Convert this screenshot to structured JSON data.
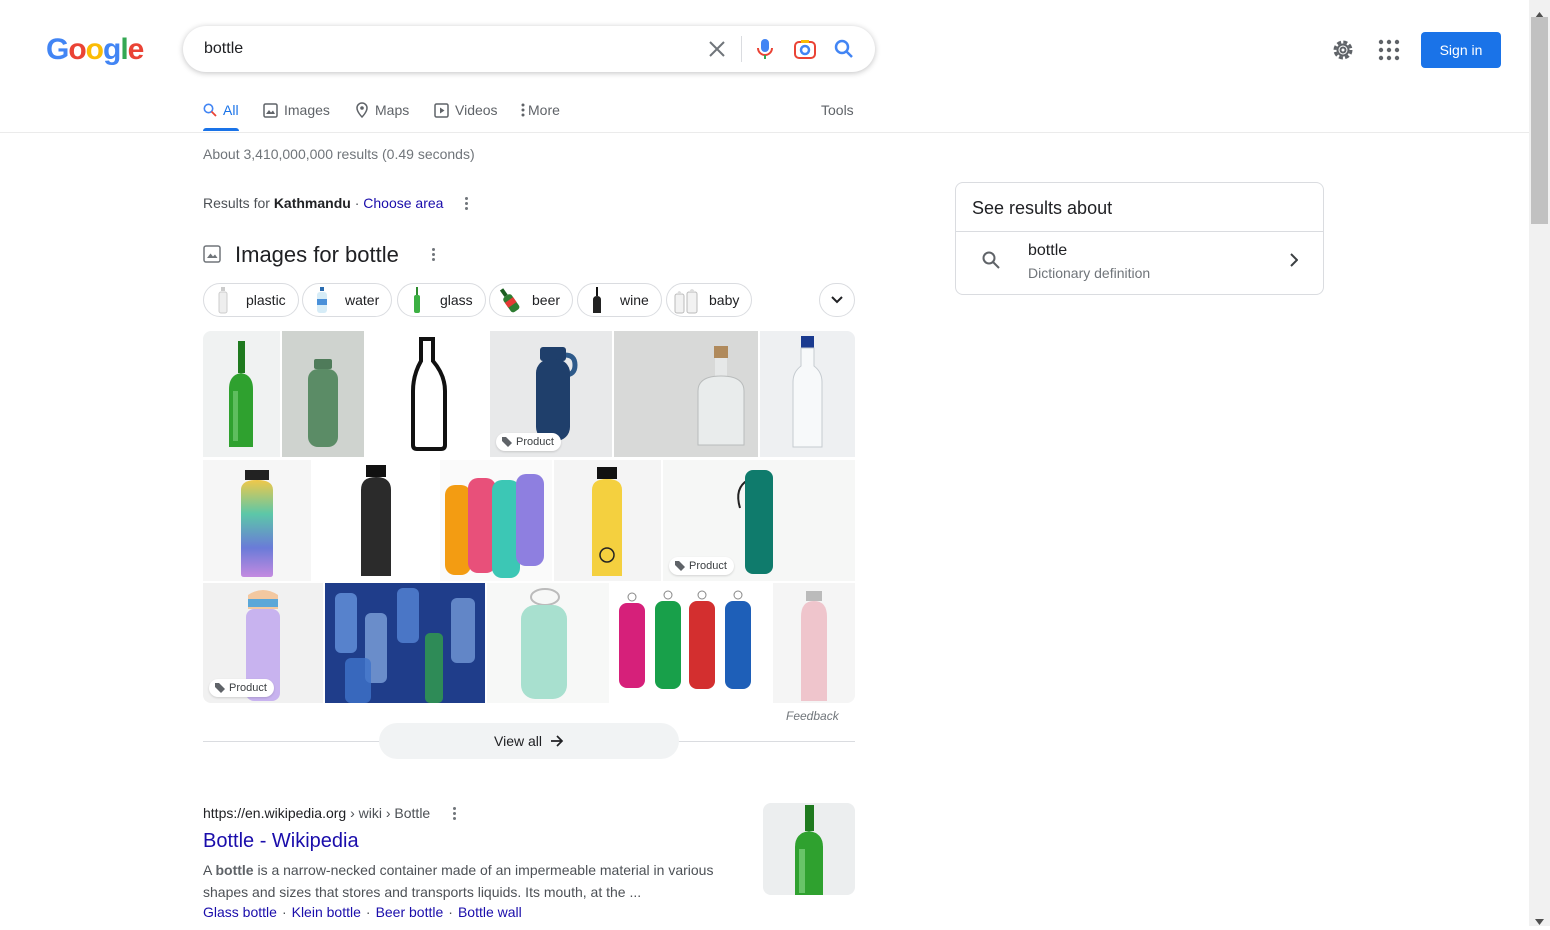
{
  "logo": {
    "letters": [
      "G",
      "o",
      "o",
      "g",
      "l",
      "e"
    ],
    "colors": [
      "#4285f4",
      "#ea4335",
      "#fbbc05",
      "#4285f4",
      "#34a853",
      "#ea4335"
    ]
  },
  "search": {
    "query": "bottle"
  },
  "header": {
    "sign_in": "Sign in"
  },
  "tabs": [
    {
      "label": "All",
      "icon": "search-icon",
      "active": true
    },
    {
      "label": "Images",
      "icon": "image-icon"
    },
    {
      "label": "Maps",
      "icon": "map-pin-icon"
    },
    {
      "label": "Videos",
      "icon": "video-icon"
    },
    {
      "label": "More",
      "icon": "more-vert-icon"
    }
  ],
  "tools_label": "Tools",
  "stats": "About 3,410,000,000 results (0.49 seconds)",
  "location": {
    "prefix": "Results for ",
    "place": "Kathmandu",
    "separator": " · ",
    "link": "Choose area"
  },
  "images_section": {
    "title": "Images for bottle",
    "chips": [
      "plastic",
      "water",
      "glass",
      "beer",
      "wine",
      "baby"
    ],
    "product_tag": "Product",
    "feedback": "Feedback",
    "view_all": "View all"
  },
  "result": {
    "url": "https://en.wikipedia.org",
    "path": " › wiki › Bottle",
    "title": "Bottle - Wikipedia",
    "snippet_bold": "bottle",
    "snippet_pre": "A ",
    "snippet_post": " is a narrow-necked container made of an impermeable material in various shapes and sizes that stores and transports liquids. Its mouth, at the ...",
    "sitelinks": [
      "Glass bottle",
      "Klein bottle",
      "Beer bottle",
      "Bottle wall"
    ]
  },
  "side_panel": {
    "title": "See results about",
    "term": "bottle",
    "subtitle": "Dictionary definition"
  },
  "colors": {
    "link": "#1a0dab",
    "accent": "#1a73e8",
    "snippet": "#4d5156"
  }
}
